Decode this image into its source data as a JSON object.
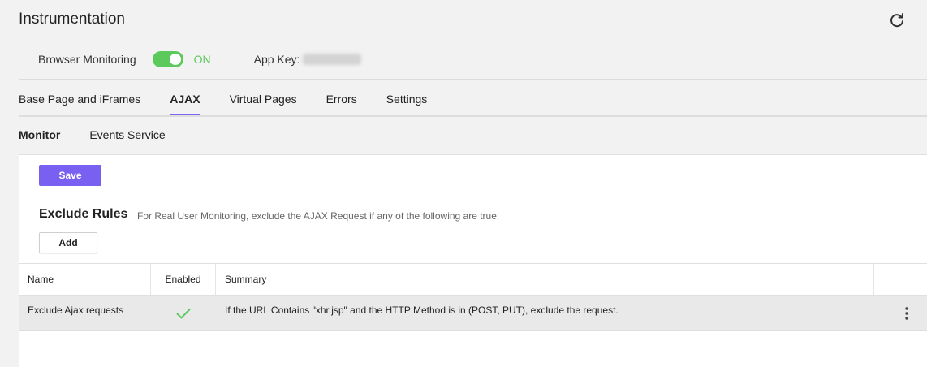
{
  "page": {
    "title": "Instrumentation"
  },
  "browser_monitoring": {
    "label": "Browser Monitoring",
    "toggle_state": "ON",
    "toggle_on": true,
    "app_key_label": "App Key:"
  },
  "tabs": [
    {
      "label": "Base Page and iFrames",
      "active": false
    },
    {
      "label": "AJAX",
      "active": true
    },
    {
      "label": "Virtual Pages",
      "active": false
    },
    {
      "label": "Errors",
      "active": false
    },
    {
      "label": "Settings",
      "active": false
    }
  ],
  "subtabs": [
    {
      "label": "Monitor",
      "active": true
    },
    {
      "label": "Events Service",
      "active": false
    }
  ],
  "toolbar": {
    "save_label": "Save"
  },
  "exclude_rules": {
    "title": "Exclude Rules",
    "description": "For Real User Monitoring, exclude the AJAX Request if any of the following are true:",
    "add_label": "Add"
  },
  "table": {
    "columns": [
      "Name",
      "Enabled",
      "Summary"
    ],
    "rows": [
      {
        "name": "Exclude Ajax requests",
        "enabled": true,
        "summary": "If the URL Contains \"xhr.jsp\" and the HTTP Method is in (POST, PUT), exclude the request."
      }
    ]
  },
  "colors": {
    "accent": "#7a60f0",
    "toggle_on": "#5bc95b",
    "check": "#5bc95b"
  },
  "icons": {
    "refresh": "refresh-icon",
    "check": "check-icon",
    "menu": "kebab-menu-icon"
  }
}
